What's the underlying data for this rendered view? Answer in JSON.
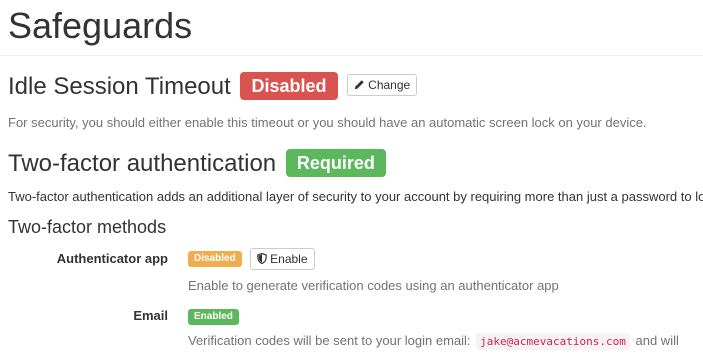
{
  "page": {
    "title": "Safeguards"
  },
  "idle_timeout": {
    "heading": "Idle Session Timeout",
    "status_label": "Disabled",
    "change_button": "Change",
    "help_text": "For security, you should either enable this timeout or you should have an automatic screen lock on your device."
  },
  "two_factor": {
    "heading": "Two-factor authentication",
    "status_label": "Required",
    "description": "Two-factor authentication adds an additional layer of security to your account by requiring more than just a password to log in.",
    "methods_heading": "Two-factor methods",
    "methods": [
      {
        "name": "Authenticator app",
        "status": "Disabled",
        "action_button": "Enable",
        "description": "Enable to generate verification codes using an authenticator app"
      },
      {
        "name": "Email",
        "status": "Enabled",
        "description_prefix": "Verification codes will be sent to your login email:",
        "email": "jake@acmevacations.com",
        "description_suffix": "and will"
      }
    ]
  },
  "colors": {
    "danger": "#d9534f",
    "success": "#5cb85c",
    "warning": "#f0ad4e",
    "muted_text": "#737373"
  },
  "icons": {
    "change": "pencil-icon",
    "enable": "shield-icon"
  }
}
